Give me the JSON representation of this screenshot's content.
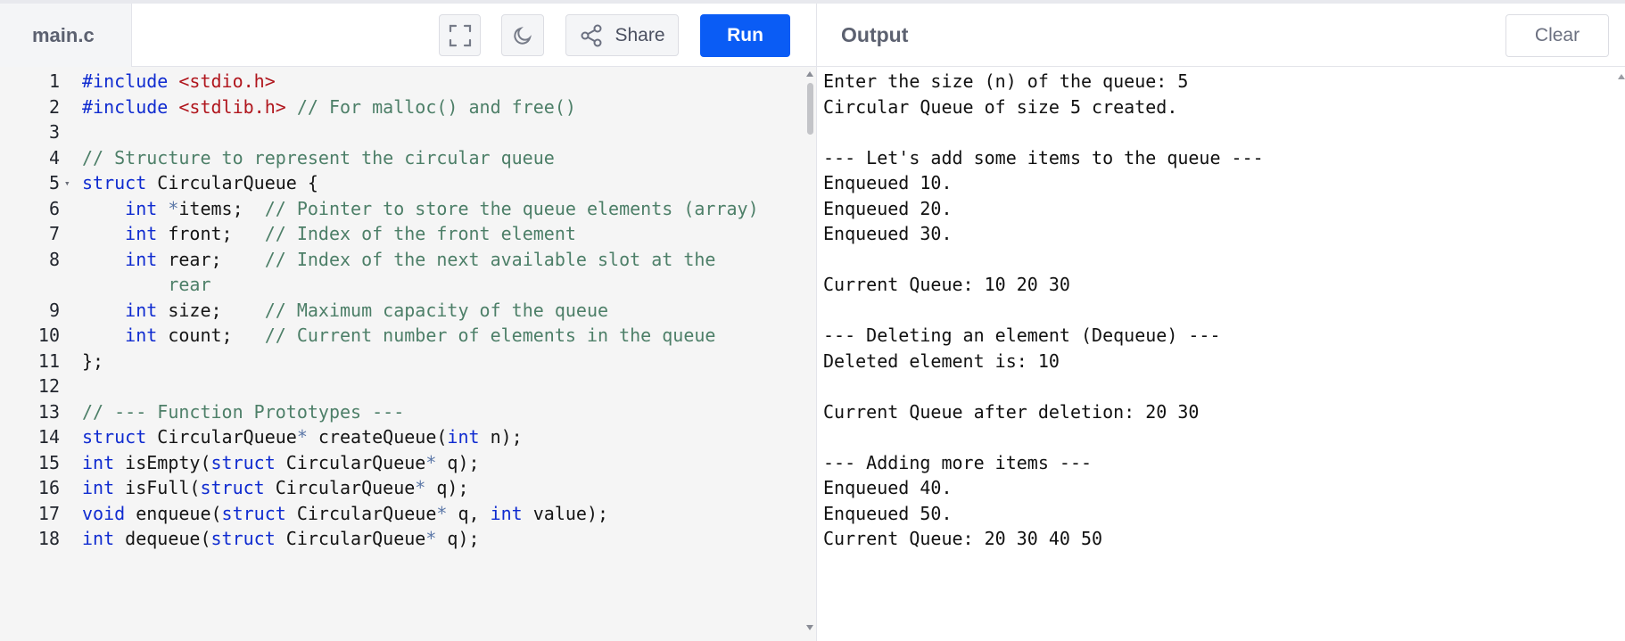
{
  "header": {
    "file_tab": "main.c",
    "share_label": "Share",
    "run_label": "Run",
    "output_title": "Output",
    "clear_label": "Clear",
    "icons": {
      "fullscreen": "fullscreen-icon",
      "theme": "moon-icon",
      "share": "share-icon"
    }
  },
  "editor": {
    "lines": [
      {
        "n": "1",
        "fold": "",
        "parts": [
          {
            "t": "#include ",
            "c": "kw"
          },
          {
            "t": "<stdio.h>",
            "c": "str"
          }
        ]
      },
      {
        "n": "2",
        "fold": "",
        "parts": [
          {
            "t": "#include ",
            "c": "kw"
          },
          {
            "t": "<stdlib.h>",
            "c": "str"
          },
          {
            "t": " // For malloc() and free()",
            "c": "cm"
          }
        ]
      },
      {
        "n": "3",
        "fold": "",
        "parts": []
      },
      {
        "n": "4",
        "fold": "",
        "parts": [
          {
            "t": "// Structure to represent the circular queue",
            "c": "cm"
          }
        ]
      },
      {
        "n": "5",
        "fold": "▾",
        "parts": [
          {
            "t": "struct",
            "c": "kw"
          },
          {
            "t": " CircularQueue {",
            "c": ""
          }
        ]
      },
      {
        "n": "6",
        "fold": "",
        "parts": [
          {
            "t": "    ",
            "c": ""
          },
          {
            "t": "int",
            "c": "kw"
          },
          {
            "t": " ",
            "c": ""
          },
          {
            "t": "*",
            "c": "op"
          },
          {
            "t": "items;  ",
            "c": ""
          },
          {
            "t": "// Pointer to store the queue elements (array)",
            "c": "cm"
          }
        ]
      },
      {
        "n": "7",
        "fold": "",
        "parts": [
          {
            "t": "    ",
            "c": ""
          },
          {
            "t": "int",
            "c": "kw"
          },
          {
            "t": " front;   ",
            "c": ""
          },
          {
            "t": "// Index of the front element",
            "c": "cm"
          }
        ]
      },
      {
        "n": "8",
        "fold": "",
        "parts": [
          {
            "t": "    ",
            "c": ""
          },
          {
            "t": "int",
            "c": "kw"
          },
          {
            "t": " rear;    ",
            "c": ""
          },
          {
            "t": "// Index of the next available slot at the",
            "c": "cm"
          }
        ]
      },
      {
        "n": "",
        "fold": "",
        "parts": [
          {
            "t": "        rear",
            "c": "cm"
          }
        ]
      },
      {
        "n": "9",
        "fold": "",
        "parts": [
          {
            "t": "    ",
            "c": ""
          },
          {
            "t": "int",
            "c": "kw"
          },
          {
            "t": " size;    ",
            "c": ""
          },
          {
            "t": "// Maximum capacity of the queue",
            "c": "cm"
          }
        ]
      },
      {
        "n": "10",
        "fold": "",
        "parts": [
          {
            "t": "    ",
            "c": ""
          },
          {
            "t": "int",
            "c": "kw"
          },
          {
            "t": " count;   ",
            "c": ""
          },
          {
            "t": "// Current number of elements in the queue",
            "c": "cm"
          }
        ]
      },
      {
        "n": "11",
        "fold": "",
        "parts": [
          {
            "t": "};",
            "c": ""
          }
        ]
      },
      {
        "n": "12",
        "fold": "",
        "parts": []
      },
      {
        "n": "13",
        "fold": "",
        "parts": [
          {
            "t": "// --- Function Prototypes ---",
            "c": "cm"
          }
        ]
      },
      {
        "n": "14",
        "fold": "",
        "parts": [
          {
            "t": "struct",
            "c": "kw"
          },
          {
            "t": " CircularQueue",
            "c": ""
          },
          {
            "t": "*",
            "c": "op"
          },
          {
            "t": " createQueue(",
            "c": ""
          },
          {
            "t": "int",
            "c": "kw"
          },
          {
            "t": " n);",
            "c": ""
          }
        ]
      },
      {
        "n": "15",
        "fold": "",
        "parts": [
          {
            "t": "int",
            "c": "kw"
          },
          {
            "t": " isEmpty(",
            "c": ""
          },
          {
            "t": "struct",
            "c": "kw"
          },
          {
            "t": " CircularQueue",
            "c": ""
          },
          {
            "t": "*",
            "c": "op"
          },
          {
            "t": " q);",
            "c": ""
          }
        ]
      },
      {
        "n": "16",
        "fold": "",
        "parts": [
          {
            "t": "int",
            "c": "kw"
          },
          {
            "t": " isFull(",
            "c": ""
          },
          {
            "t": "struct",
            "c": "kw"
          },
          {
            "t": " CircularQueue",
            "c": ""
          },
          {
            "t": "*",
            "c": "op"
          },
          {
            "t": " q);",
            "c": ""
          }
        ]
      },
      {
        "n": "17",
        "fold": "",
        "parts": [
          {
            "t": "void",
            "c": "kw"
          },
          {
            "t": " enqueue(",
            "c": ""
          },
          {
            "t": "struct",
            "c": "kw"
          },
          {
            "t": " CircularQueue",
            "c": ""
          },
          {
            "t": "*",
            "c": "op"
          },
          {
            "t": " q, ",
            "c": ""
          },
          {
            "t": "int",
            "c": "kw"
          },
          {
            "t": " value);",
            "c": ""
          }
        ]
      },
      {
        "n": "18",
        "fold": "",
        "parts": [
          {
            "t": "int",
            "c": "kw"
          },
          {
            "t": " dequeue(",
            "c": ""
          },
          {
            "t": "struct",
            "c": "kw"
          },
          {
            "t": " CircularQueue",
            "c": ""
          },
          {
            "t": "*",
            "c": "op"
          },
          {
            "t": " q);",
            "c": ""
          }
        ]
      }
    ]
  },
  "output": {
    "lines": [
      "Enter the size (n) of the queue: 5",
      "Circular Queue of size 5 created.",
      "",
      "--- Let's add some items to the queue ---",
      "Enqueued 10.",
      "Enqueued 20.",
      "Enqueued 30.",
      "",
      "Current Queue: 10 20 30",
      "",
      "--- Deleting an element (Dequeue) ---",
      "Deleted element is: 10",
      "",
      "Current Queue after deletion: 20 30",
      "",
      "--- Adding more items ---",
      "Enqueued 40.",
      "Enqueued 50.",
      "Current Queue: 20 30 40 50"
    ]
  },
  "colors": {
    "run_button": "#0a5cf5",
    "keyword": "#0f2bd0",
    "string": "#b0161d",
    "comment": "#4d7f68",
    "editor_bg": "#f5f5f5"
  }
}
